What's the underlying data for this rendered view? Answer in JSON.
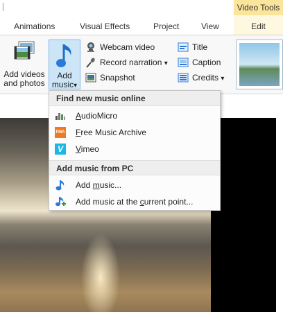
{
  "context_tab_header": "Video Tools",
  "tabs": [
    {
      "label": "Animations"
    },
    {
      "label": "Visual Effects"
    },
    {
      "label": "Project"
    },
    {
      "label": "View"
    },
    {
      "label": "Edit"
    }
  ],
  "ribbon": {
    "add_videos": {
      "line1": "Add videos",
      "line2": "and photos"
    },
    "add_music": {
      "line1": "Add",
      "line2": "music",
      "arrow": "▾"
    },
    "webcam_video": "Webcam video",
    "record_narration": "Record narration",
    "snapshot": "Snapshot",
    "title": "Title",
    "caption": "Caption",
    "credits": "Credits",
    "dropdown_arrow": "▾"
  },
  "menu": {
    "section_online": "Find new music online",
    "online_items": [
      {
        "first": "A",
        "rest": "udioMicro",
        "icon": "audiomicro-icon"
      },
      {
        "first": "F",
        "rest": "ree Music Archive",
        "icon": "fma-icon",
        "icon_text": "FMA"
      },
      {
        "first": "V",
        "rest": "imeo",
        "icon": "vimeo-icon",
        "icon_text": "V"
      }
    ],
    "section_pc": "Add music from PC",
    "add_music": {
      "before": "Add ",
      "key": "m",
      "after": "usic..."
    },
    "add_music_current": {
      "before": "Add music at the ",
      "key": "c",
      "after": "urrent point..."
    }
  },
  "colors": {
    "context_header_bg": "#fbe59b",
    "selected_button_bg": "#cde6f7",
    "accent_blue": "#2b79d8",
    "fma_orange": "#f07a22",
    "vimeo_blue": "#1ab7ea"
  }
}
